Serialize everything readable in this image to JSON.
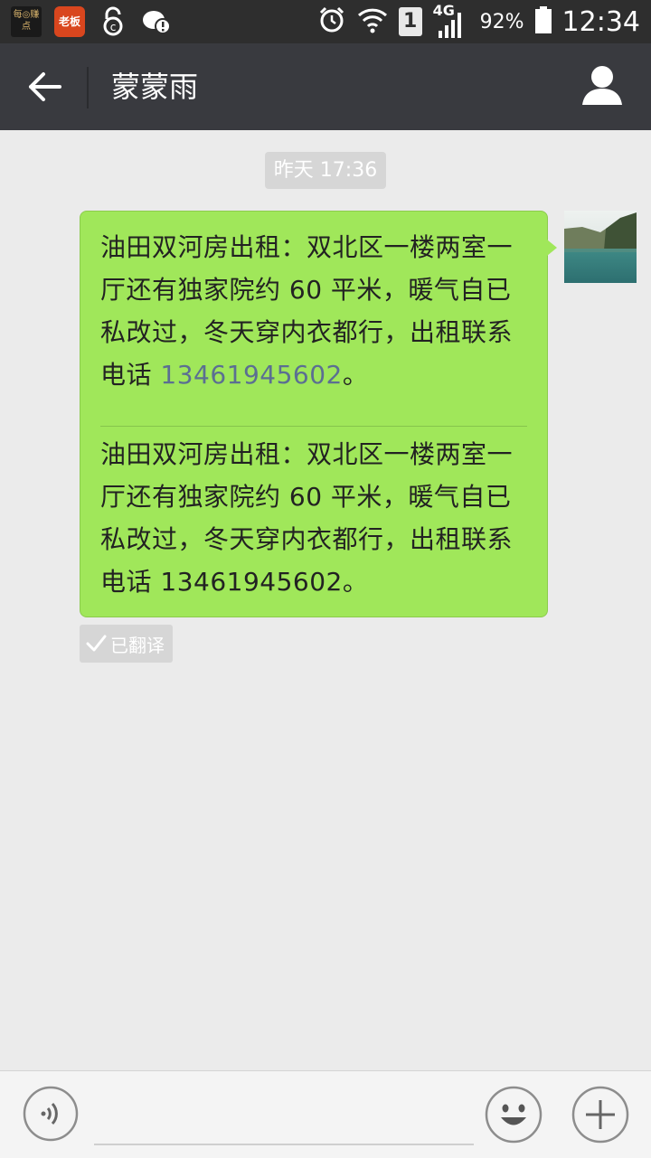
{
  "status_bar": {
    "app1_text": "每◎赚点",
    "app2_text": "老板",
    "sim_slot": "1",
    "network": "4G",
    "battery": "92%",
    "time": "12:34"
  },
  "title_bar": {
    "title": "蒙蒙雨"
  },
  "chat": {
    "timestamp": "昨天 17:36",
    "message": {
      "original_before_phone": "油田双河房出租：双北区一楼两室一厅还有独家院约 60 平米，暖气自已私改过，冬天穿内衣都行，出租联系电话 ",
      "phone": "13461945602",
      "original_after_phone": "。",
      "translated": "油田双河房出租：双北区一楼两室一厅还有独家院约 60 平米，暖气自已私改过，冬天穿内衣都行，出租联系电话 13461945602。"
    },
    "translated_label": "已翻译"
  },
  "input_bar": {
    "placeholder": ""
  },
  "icons": {
    "back": "back-arrow-icon",
    "profile": "user-icon",
    "voice": "voice-icon",
    "emoji": "emoji-icon",
    "more": "plus-icon"
  },
  "colors": {
    "bubble": "#a0e75a",
    "title_bar": "#393a3f",
    "status_bar": "#2e2e2e",
    "background": "#ebebeb",
    "phone_link": "#5b6f92"
  }
}
